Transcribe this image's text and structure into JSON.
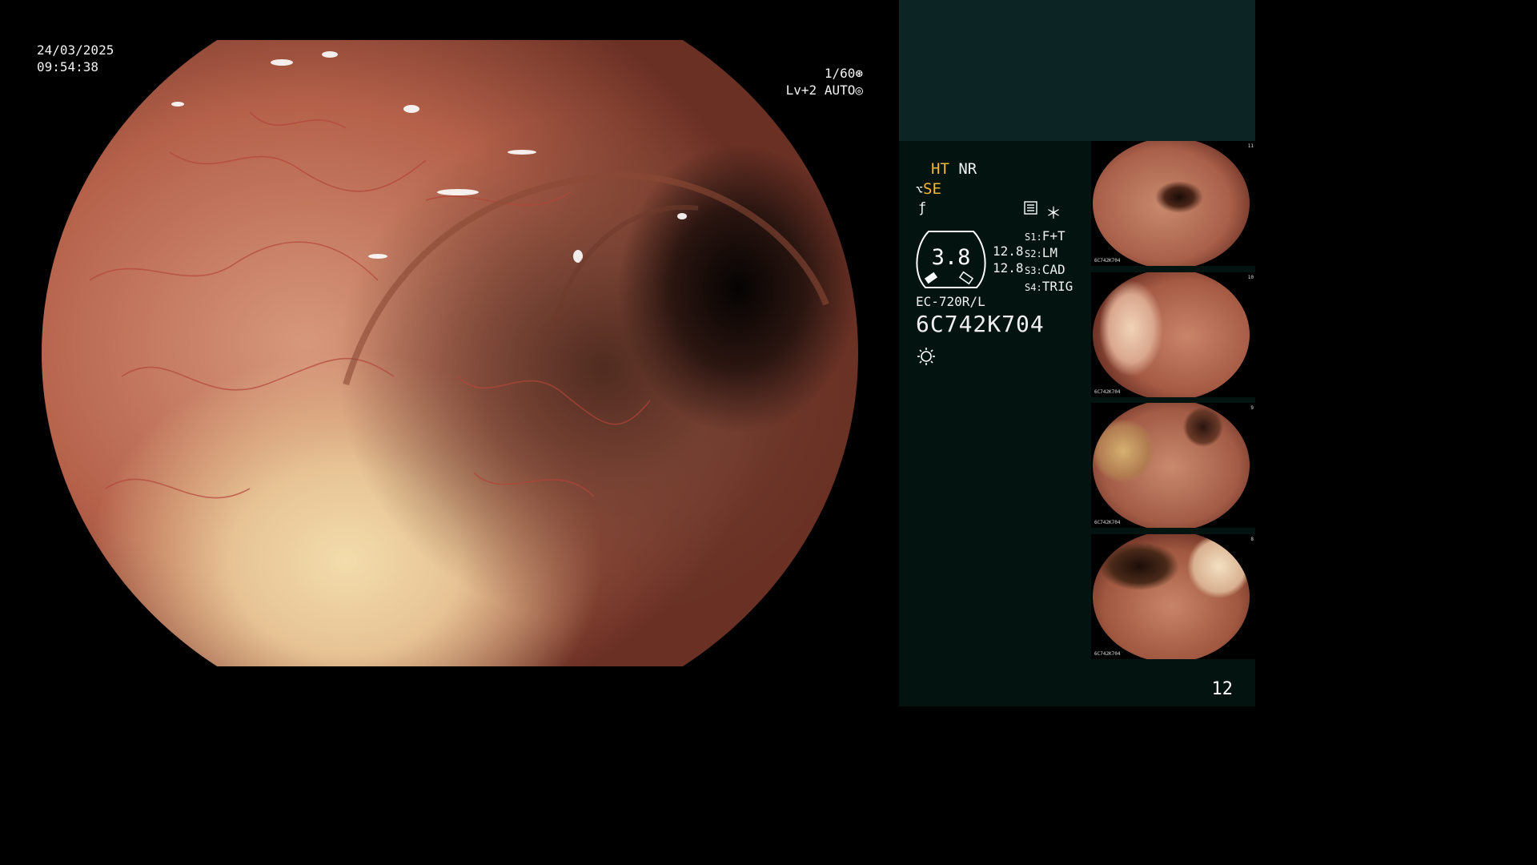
{
  "overlay": {
    "date": "24/03/2025",
    "time": "09:54:38",
    "shutter": "1/60",
    "level": "Lv+2 AUTO"
  },
  "status": {
    "ht": "HT",
    "nr": "NR",
    "se": "SE",
    "zoom": "3.8",
    "val1": "12.8",
    "val2": "12.8",
    "s_labels": [
      {
        "key": "S1:",
        "value": "F+T"
      },
      {
        "key": "S2:",
        "value": "LM"
      },
      {
        "key": "S3:",
        "value": "CAD"
      },
      {
        "key": "S4:",
        "value": "TRIG"
      }
    ],
    "model": "EC-720R/L",
    "serial": "6C742K704"
  },
  "thumbnails": [
    {
      "caption": "6C742K704",
      "num": "11"
    },
    {
      "caption": "6C742K704",
      "num": "10"
    },
    {
      "caption": "6C742K704",
      "num": "9"
    },
    {
      "caption": "6C742K704",
      "num": "8"
    }
  ],
  "page_number": "12",
  "icons": [
    "shutter-icon",
    "auto-icon",
    "scissor-icon",
    "f-icon",
    "settings-box-icon",
    "asterisk-icon",
    "light-icon"
  ],
  "colors": {
    "highlight": "#f5b731",
    "panel": "#031410",
    "panel_top": "#0c2424"
  }
}
